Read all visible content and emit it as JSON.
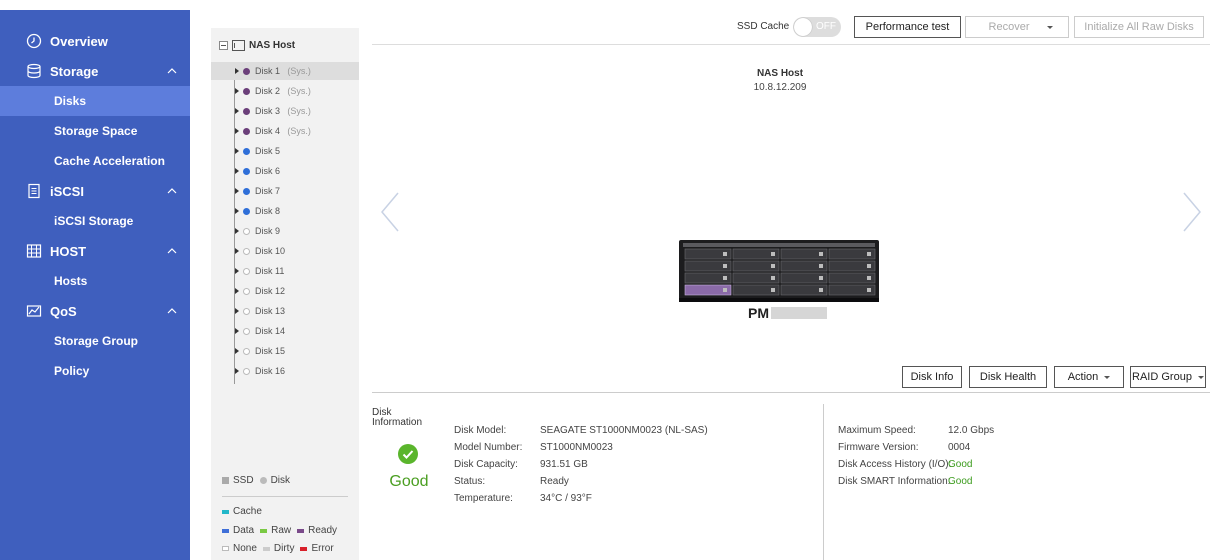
{
  "sidebar": {
    "items": [
      {
        "label": "Overview",
        "type": "section",
        "icon": "clock-icon"
      },
      {
        "label": "Storage",
        "type": "section",
        "icon": "database-icon"
      },
      {
        "label": "Disks",
        "type": "sub",
        "active": true
      },
      {
        "label": "Storage Space",
        "type": "sub"
      },
      {
        "label": "Cache Acceleration",
        "type": "sub"
      },
      {
        "label": "iSCSI",
        "type": "section",
        "icon": "document-icon"
      },
      {
        "label": "iSCSI Storage",
        "type": "sub"
      },
      {
        "label": "HOST",
        "type": "section",
        "icon": "server-grid-icon"
      },
      {
        "label": "Hosts",
        "type": "sub"
      },
      {
        "label": "QoS",
        "type": "section",
        "icon": "chart-icon"
      },
      {
        "label": "Storage Group",
        "type": "sub"
      },
      {
        "label": "Policy",
        "type": "sub"
      }
    ]
  },
  "tree": {
    "root": "NAS Host",
    "disks": [
      {
        "label": "Disk 1",
        "suffix": "(Sys.)",
        "color": "#6b3f7a"
      },
      {
        "label": "Disk 2",
        "suffix": "(Sys.)",
        "color": "#6b3f7a"
      },
      {
        "label": "Disk 3",
        "suffix": "(Sys.)",
        "color": "#6b3f7a"
      },
      {
        "label": "Disk 4",
        "suffix": "(Sys.)",
        "color": "#6b3f7a"
      },
      {
        "label": "Disk 5",
        "suffix": "",
        "color": "#2f6fd8"
      },
      {
        "label": "Disk 6",
        "suffix": "",
        "color": "#2f6fd8"
      },
      {
        "label": "Disk 7",
        "suffix": "",
        "color": "#2f6fd8"
      },
      {
        "label": "Disk 8",
        "suffix": "",
        "color": "#2f6fd8"
      },
      {
        "label": "Disk 9",
        "suffix": "",
        "color": "none"
      },
      {
        "label": "Disk 10",
        "suffix": "",
        "color": "none"
      },
      {
        "label": "Disk 11",
        "suffix": "",
        "color": "none"
      },
      {
        "label": "Disk 12",
        "suffix": "",
        "color": "none"
      },
      {
        "label": "Disk 13",
        "suffix": "",
        "color": "none"
      },
      {
        "label": "Disk 14",
        "suffix": "",
        "color": "none"
      },
      {
        "label": "Disk 15",
        "suffix": "",
        "color": "none"
      },
      {
        "label": "Disk 16",
        "suffix": "",
        "color": "none"
      }
    ],
    "legend": {
      "ssd": "SSD",
      "disk": "Disk",
      "cache": "Cache",
      "data": "Data",
      "raw": "Raw",
      "ready": "Ready",
      "none": "None",
      "dirty": "Dirty",
      "error": "Error"
    }
  },
  "toolbar": {
    "ssd_cache_label": "SSD Cache",
    "toggle_state": "OFF",
    "performance_test": "Performance test",
    "recover": "Recover",
    "initialize": "Initialize All Raw Disks"
  },
  "host": {
    "name": "NAS Host",
    "ip": "10.8.12.209",
    "device_prefix": "PM"
  },
  "actions": {
    "disk_info": "Disk Info",
    "disk_health": "Disk Health",
    "action": "Action",
    "raid_group": "RAID Group"
  },
  "info": {
    "heading": "Disk Information",
    "status_text": "Good",
    "left": [
      {
        "key": "Disk Model:",
        "value": "SEAGATE ST1000NM0023 (NL-SAS)"
      },
      {
        "key": "Model Number:",
        "value": "ST1000NM0023"
      },
      {
        "key": "Disk Capacity:",
        "value": "931.51 GB"
      },
      {
        "key": "Status:",
        "value": "Ready"
      },
      {
        "key": "Temperature:",
        "value": "34°C / 93°F"
      }
    ],
    "right": [
      {
        "key": "Maximum Speed:",
        "value": "12.0 Gbps",
        "green": false
      },
      {
        "key": "Firmware Version:",
        "value": "0004",
        "green": false
      },
      {
        "key": "Disk Access History (I/O):",
        "value": "Good",
        "green": true
      },
      {
        "key": "Disk SMART Information:",
        "value": "Good",
        "green": true
      }
    ]
  }
}
